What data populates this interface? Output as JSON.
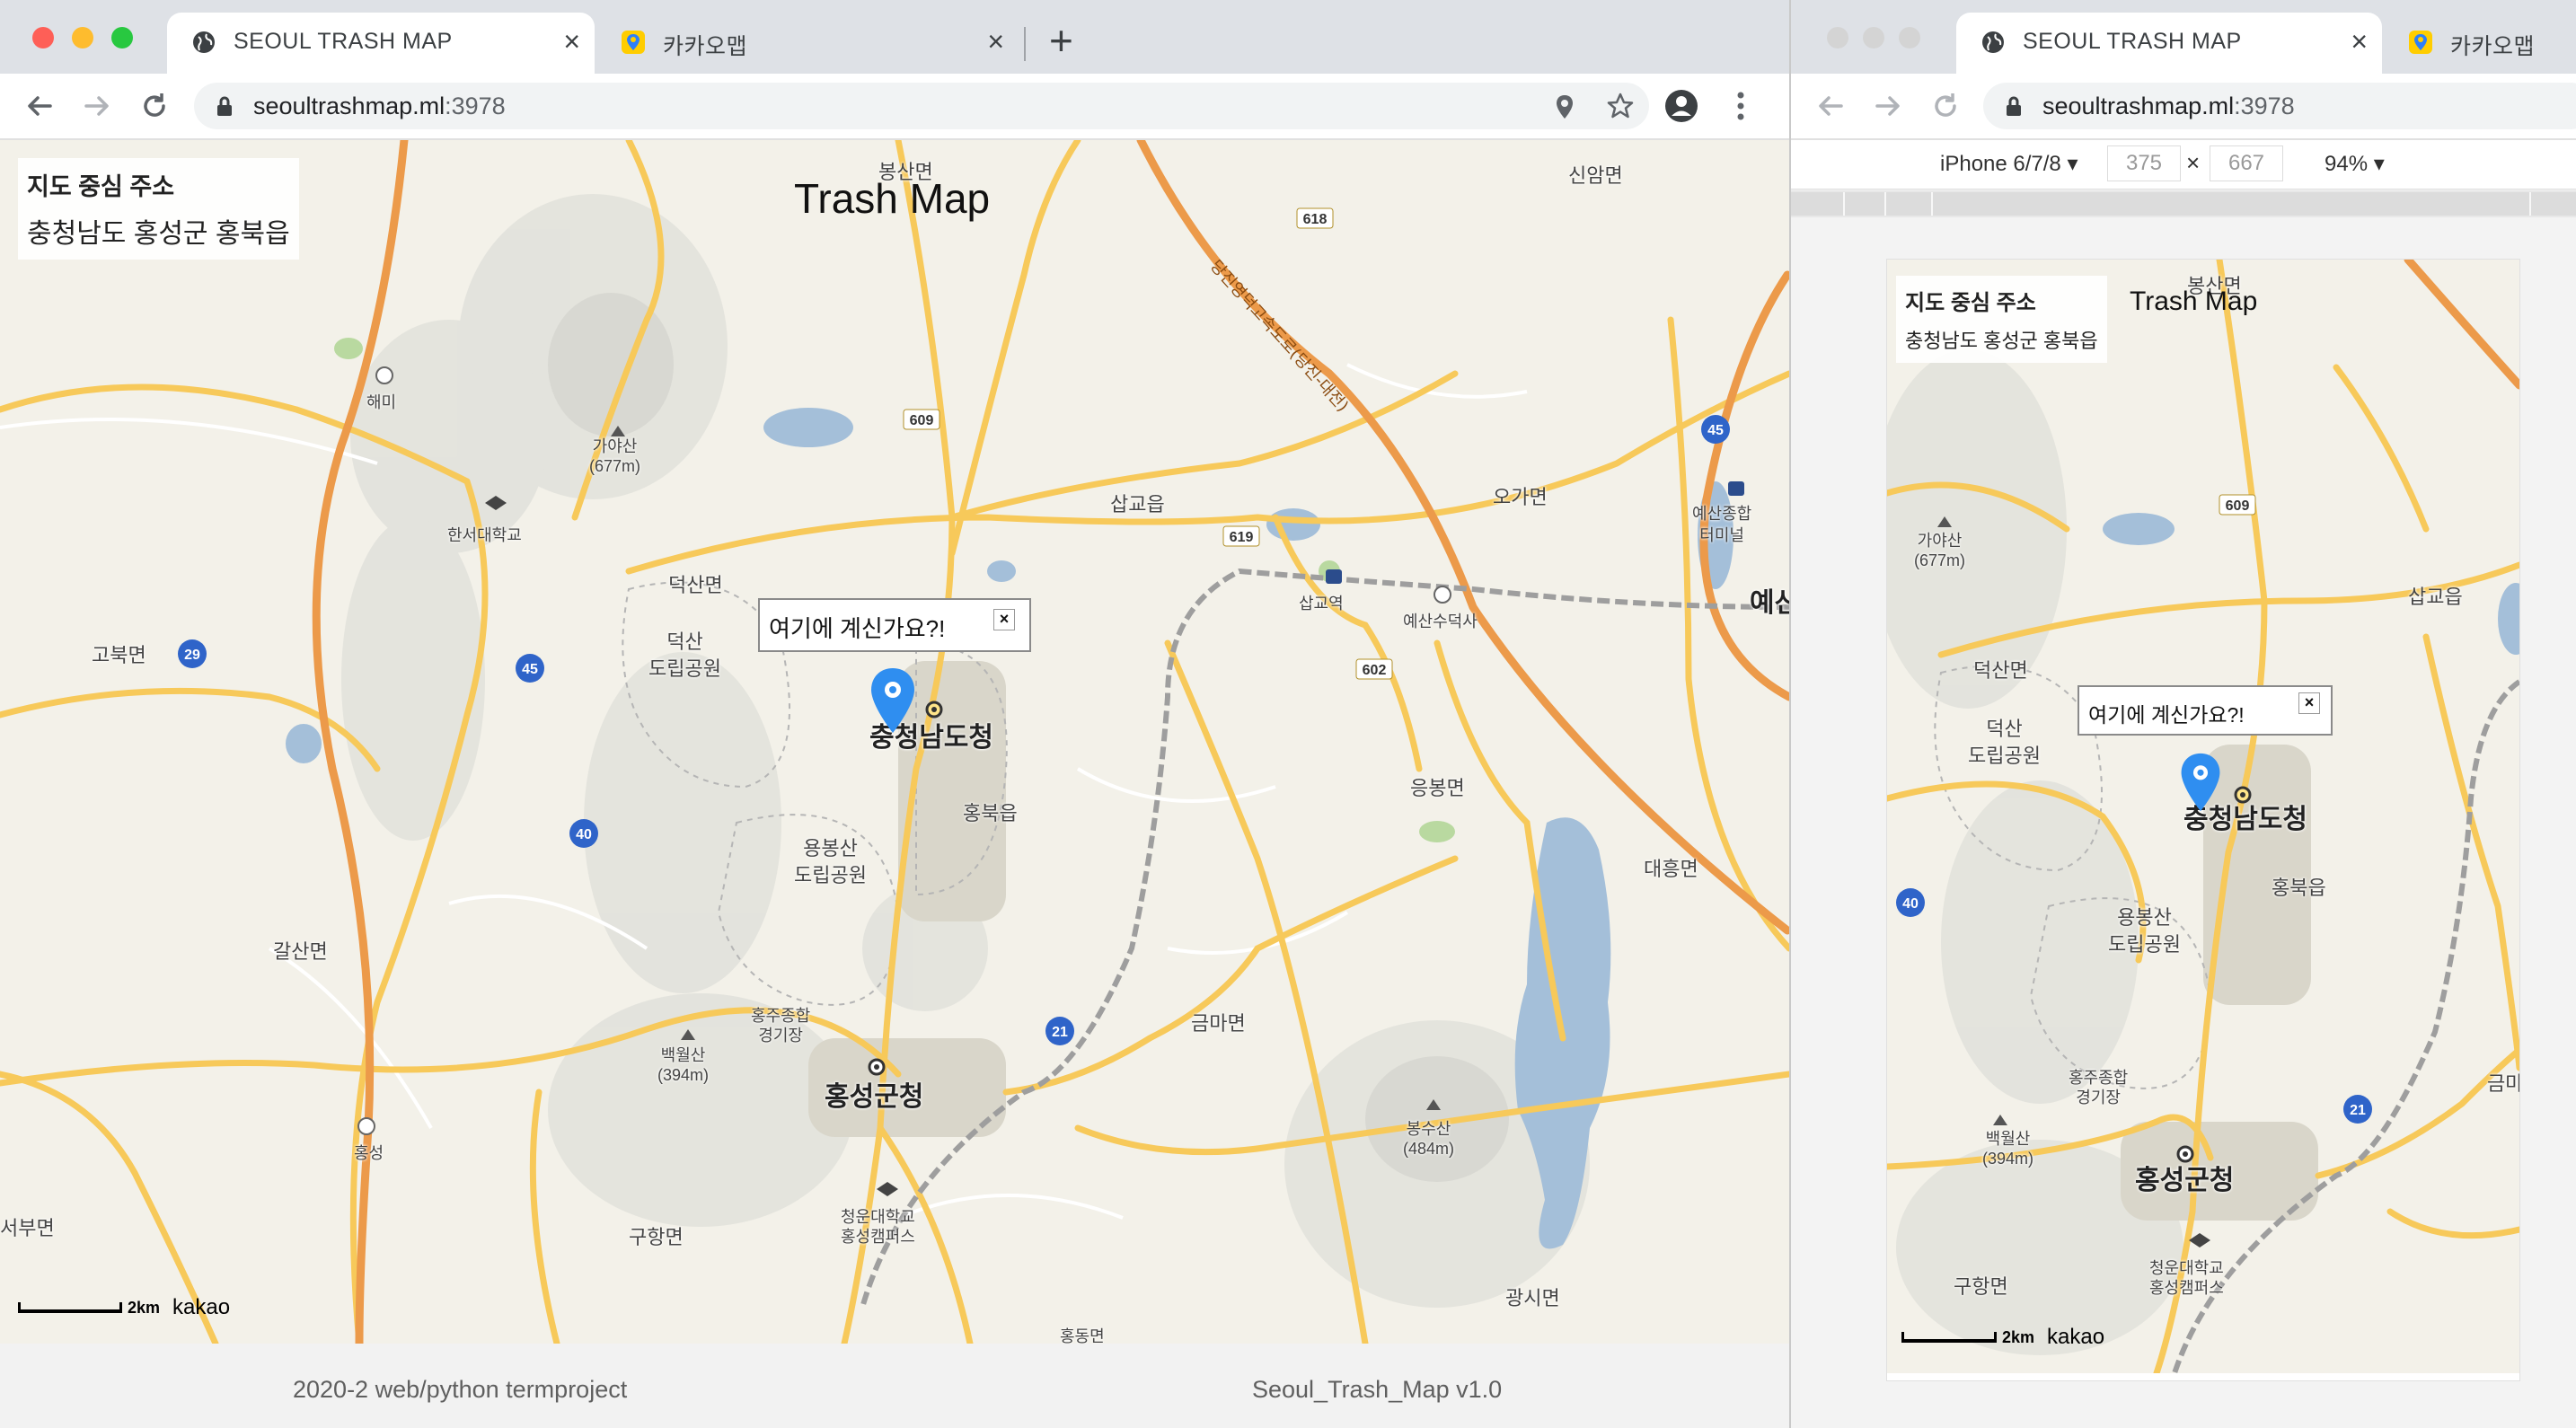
{
  "left_window": {
    "tabs": [
      {
        "title": "SEOUL TRASH MAP",
        "active": true
      },
      {
        "title": "카카오맵",
        "active": false
      }
    ],
    "new_tab": "+",
    "url": {
      "host": "seoultrashmap.ml",
      "port": ":3978"
    },
    "map": {
      "address_label": "지도 중심 주소",
      "address_value": "충청남도 홍성군 홍북읍",
      "title": "Trash Map",
      "infowindow": "여기에 계신가요?!",
      "close": "×",
      "scale": "2km",
      "brand": "kakao",
      "places": {
        "p1": "봉산면",
        "p2": "신암면",
        "p3": "해미",
        "p4": "가야산",
        "p5": "(677m)",
        "p6": "한서대학교",
        "p7": "삽교읍",
        "p8": "오가면",
        "p9": "예산종합",
        "p10": "터미널",
        "p11": "덕산면",
        "p12": "덕산",
        "p13": "도립공원",
        "p14": "삽교역",
        "p15": "예산수덕사",
        "p16": "고북면",
        "p17": "충청남도청",
        "p18": "홍북읍",
        "p19": "응봉면",
        "p20": "대흥면",
        "p21": "용봉산",
        "p22": "도립공원",
        "p23": "갈산면",
        "p24": "홍주종합",
        "p25": "경기장",
        "p26": "금마면",
        "p27": "백월산",
        "p28": "(394m)",
        "p29": "홍성군청",
        "p30": "홍성",
        "p31": "봉수산",
        "p32": "(484m)",
        "p33": "서부면",
        "p34": "구항면",
        "p35": "청운대학교",
        "p36": "홍성캠퍼스",
        "p37": "광시면",
        "p38": "예산",
        "p39": "당진영덕고속도로(당진-대전)",
        "p40": "홍동면"
      },
      "road_numbers": [
        "618",
        "609",
        "619",
        "602",
        "29",
        "45",
        "40",
        "21",
        "45"
      ]
    },
    "footer": {
      "left": "2020-2 web/python termproject",
      "right": "Seoul_Trash_Map v1.0"
    }
  },
  "right_window": {
    "tabs": [
      {
        "title": "SEOUL TRASH MAP",
        "active": true
      },
      {
        "title": "카카오맵",
        "active": false
      }
    ],
    "url": {
      "host": "seoultrashmap.ml",
      "port": ":3978"
    },
    "device_toolbar": {
      "device": "iPhone 6/7/8 ▾",
      "width": "375",
      "height": "667",
      "x": "×",
      "zoom": "94% ▾"
    },
    "map": {
      "address_label": "지도 중심 주소",
      "address_value": "충청남도 홍성군 홍북읍",
      "title": "Trash Map",
      "infowindow": "여기에 계신가요?!",
      "close": "×",
      "scale": "2km",
      "brand": "kakao",
      "places": {
        "m1": "봉산면",
        "m2": "가야산",
        "m3": "(677m)",
        "m4": "삽교읍",
        "m5": "덕산면",
        "m6": "덕산",
        "m7": "도립공원",
        "m8": "충청남도청",
        "m9": "홍북읍",
        "m10": "용봉산",
        "m11": "도립공원",
        "m12": "홍주종합",
        "m13": "경기장",
        "m14": "백월산",
        "m15": "(394m)",
        "m16": "홍성군청",
        "m17": "금마",
        "m18": "청운대학교",
        "m19": "홍성캠퍼스",
        "m20": "구항면"
      }
    }
  },
  "colors": {
    "map_bg": "#f3f1e9",
    "road_major": "#f7c95a",
    "highway": "#ec9a4a",
    "water": "#a4bfd9",
    "park_outline": "#bdbdbd",
    "marker": "#2f8ef0"
  }
}
